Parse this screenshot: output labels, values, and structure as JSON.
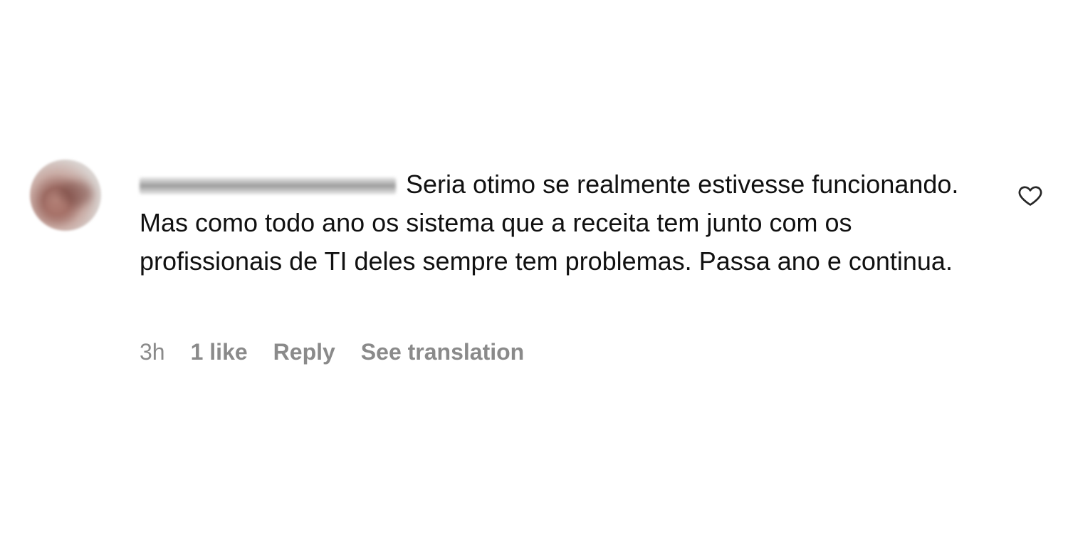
{
  "comment": {
    "text": "Seria otimo se realmente estivesse funcionando. Mas como todo ano os sistema que a receita tem junto com os profissionais de TI deles sempre tem problemas. Passa ano e continua.",
    "timestamp": "3h",
    "likes": "1 like",
    "reply_label": "Reply",
    "translate_label": "See translation",
    "like_icon": "heart-outline-icon"
  }
}
